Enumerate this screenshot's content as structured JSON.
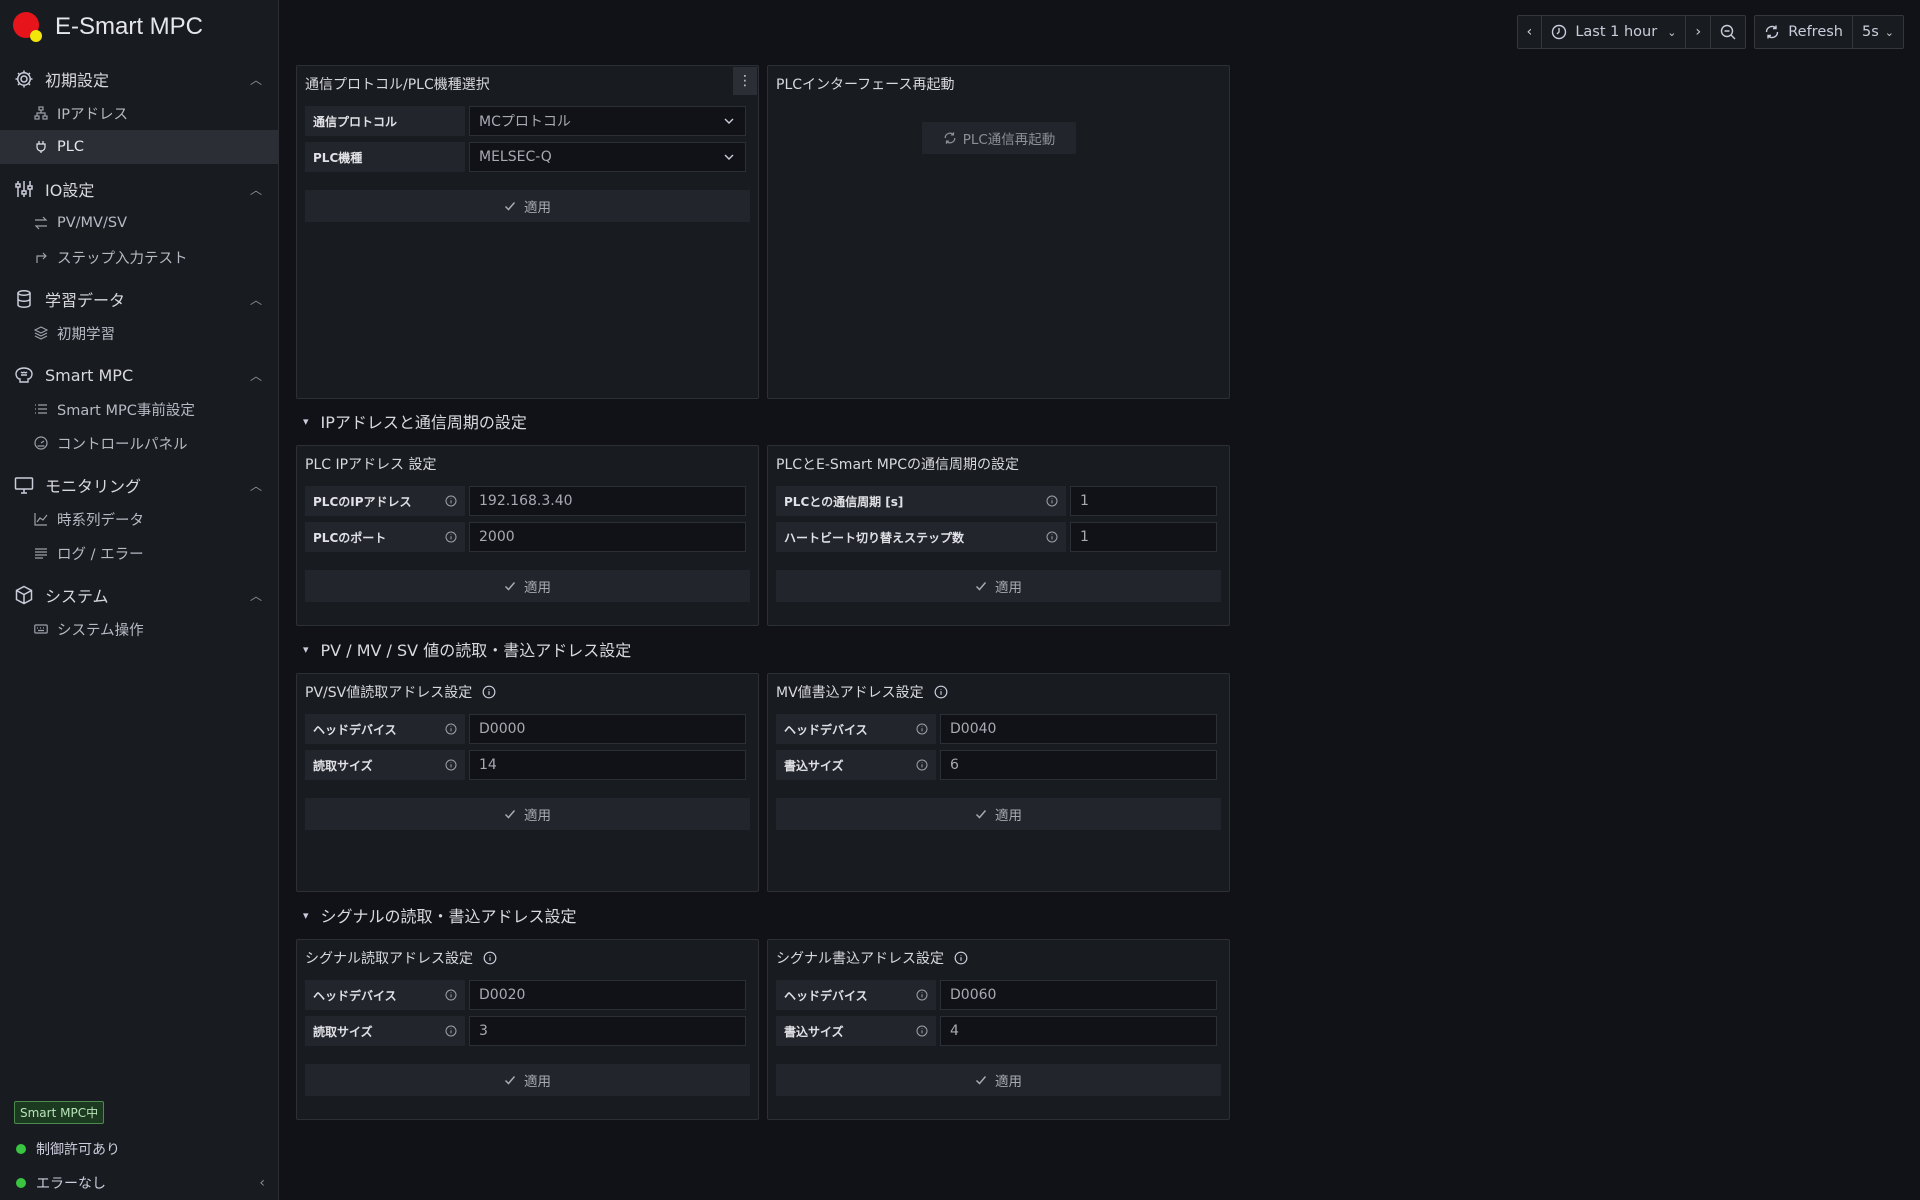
{
  "app": {
    "title": "E-Smart MPC"
  },
  "sidebar": {
    "groups": [
      {
        "label": "初期設定",
        "icon": "gear-icon",
        "items": [
          {
            "label": "IPアドレス",
            "icon": "network-icon"
          },
          {
            "label": "PLC",
            "icon": "plug-icon"
          }
        ]
      },
      {
        "label": "IO設定",
        "icon": "sliders-icon",
        "items": [
          {
            "label": "PV/MV/SV",
            "icon": "arrows-exchange-icon"
          },
          {
            "label": "ステップ入力テスト",
            "icon": "corner-arrow-icon"
          }
        ]
      },
      {
        "label": "学習データ",
        "icon": "database-icon",
        "items": [
          {
            "label": "初期学習",
            "icon": "layers-icon"
          }
        ]
      },
      {
        "label": "Smart MPC",
        "icon": "brain-icon",
        "items": [
          {
            "label": "Smart MPC事前設定",
            "icon": "list-icon"
          },
          {
            "label": "コントロールパネル",
            "icon": "dashboard-icon"
          }
        ]
      },
      {
        "label": "モニタリング",
        "icon": "monitor-icon",
        "items": [
          {
            "label": "時系列データ",
            "icon": "chart-line-icon"
          },
          {
            "label": "ログ / エラー",
            "icon": "align-left-icon"
          }
        ]
      },
      {
        "label": "システム",
        "icon": "cube-icon",
        "items": [
          {
            "label": "システム操作",
            "icon": "keyboard-icon"
          }
        ]
      }
    ],
    "active_item": "PLC",
    "footer": {
      "badge": "Smart MPC中",
      "status1": "制御許可あり",
      "status2": "エラーなし"
    }
  },
  "toolbar": {
    "time_range": "Last 1 hour",
    "refresh_label": "Refresh",
    "refresh_interval": "5s"
  },
  "panels": {
    "protocol": {
      "title": "通信プロトコル/PLC機種選択",
      "protocol_label": "通信プロトコル",
      "protocol_value": "MCプロトコル",
      "model_label": "PLC機種",
      "model_value": "MELSEC-Q",
      "apply": "適用"
    },
    "restart": {
      "title": "PLCインターフェース再起動",
      "button": "PLC通信再起動"
    },
    "ip_section": "IPアドレスと通信周期の設定",
    "ip": {
      "title": "PLC IPアドレス 設定",
      "ip_label": "PLCのIPアドレス",
      "ip_value": "192.168.3.40",
      "port_label": "PLCのポート",
      "port_value": "2000",
      "apply": "適用"
    },
    "cycle": {
      "title": "PLCとE-Smart MPCの通信周期の設定",
      "period_label": "PLCとの通信周期 [s]",
      "period_value": "1",
      "hb_label": "ハートビート切り替えステップ数",
      "hb_value": "1",
      "apply": "適用"
    },
    "pv_section": "PV / MV / SV 値の読取・書込アドレス設定",
    "pvsv": {
      "title": "PV/SV値読取アドレス設定",
      "head_label": "ヘッドデバイス",
      "head_value": "D0000",
      "size_label": "読取サイズ",
      "size_value": "14",
      "apply": "適用"
    },
    "mv": {
      "title": "MV値書込アドレス設定",
      "head_label": "ヘッドデバイス",
      "head_value": "D0040",
      "size_label": "書込サイズ",
      "size_value": "6",
      "apply": "適用"
    },
    "sig_section": "シグナルの読取・書込アドレス設定",
    "sigread": {
      "title": "シグナル読取アドレス設定",
      "head_label": "ヘッドデバイス",
      "head_value": "D0020",
      "size_label": "読取サイズ",
      "size_value": "3",
      "apply": "適用"
    },
    "sigwrite": {
      "title": "シグナル書込アドレス設定",
      "head_label": "ヘッドデバイス",
      "head_value": "D0060",
      "size_label": "書込サイズ",
      "size_value": "4",
      "apply": "適用"
    }
  },
  "colors": {
    "background": "#111217",
    "panel": "#181b1f",
    "status_green": "#39c442",
    "logo_red": "#e8141b",
    "logo_yellow": "#f2e50b"
  }
}
